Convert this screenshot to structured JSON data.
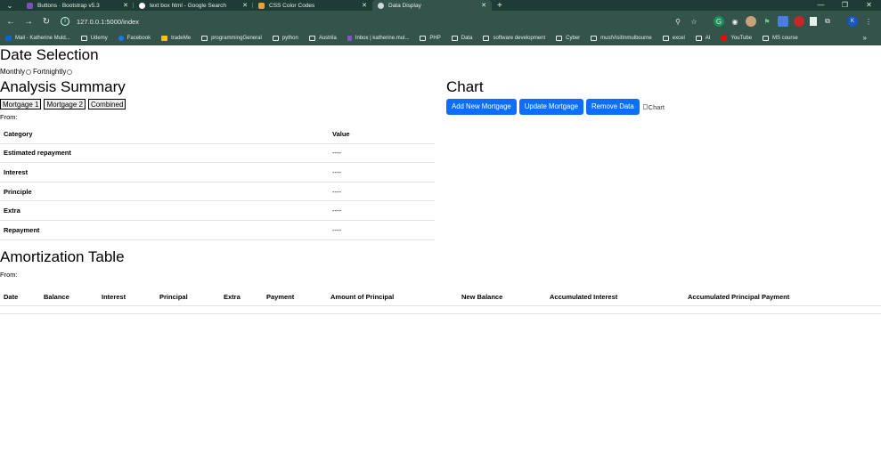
{
  "browser": {
    "tabs": [
      {
        "label": "Buttons · Bootstrap v5.3",
        "color": "#7952b3",
        "active": false
      },
      {
        "label": "text box html - Google Search",
        "color": "#ffffff",
        "active": false
      },
      {
        "label": "CSS Color Codes",
        "color": "#e8a33d",
        "active": false
      },
      {
        "label": "Data Display",
        "color": "#cfd8dc",
        "active": true
      }
    ],
    "url": "127.0.0.1:5000/index",
    "profile_initial": "K",
    "bookmarks": [
      "Mail - Katherine Muld...",
      "Udemy",
      "Facebook",
      "tradeMe",
      "programmingGeneral",
      "python",
      "Austrila",
      "Inbox | katherine.mul...",
      "PHP",
      "Data",
      "software development",
      "Cyber",
      "mustVisitInmulbourne",
      "excel",
      "AI",
      "YouTube",
      "MS course"
    ]
  },
  "date_selection": {
    "title": "Date Selection",
    "options": [
      "Monthly",
      "Fortnightly"
    ]
  },
  "analysis": {
    "title": "Analysis Summary",
    "buttons": [
      "Mortgage 1",
      "Mortgage 2",
      "Combined"
    ],
    "from_label": "From:",
    "headers": [
      "Category",
      "Value"
    ],
    "rows": [
      {
        "category": "Estimated repayment",
        "value": "----"
      },
      {
        "category": "Interest",
        "value": "----"
      },
      {
        "category": "Principle",
        "value": "----"
      },
      {
        "category": "Extra",
        "value": "----"
      },
      {
        "category": "Repayment",
        "value": "----"
      }
    ]
  },
  "chart": {
    "title": "Chart",
    "buttons": [
      "Add New Mortgage",
      "Update Mortgage",
      "Remove Data"
    ],
    "img_alt": "Chart"
  },
  "amortization": {
    "title": "Amortization Table",
    "from_label": "From:",
    "headers": [
      "Date",
      "Balance",
      "Interest",
      "Principal",
      "Extra",
      "Payment",
      "Amount of Principal",
      "New Balance",
      "Accumulated Interest",
      "Accumulated Principal Payment"
    ]
  }
}
